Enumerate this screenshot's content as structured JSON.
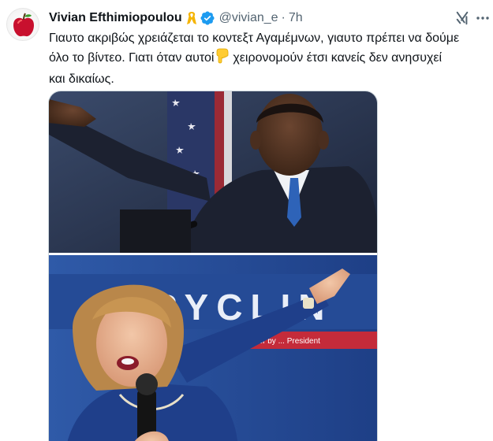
{
  "author": {
    "display_name": "Vivian Efthimiopoulou",
    "handle": "@vivian_e",
    "separator": "·",
    "time": "7h",
    "avatar_icon": "red-apple-icon",
    "badge_icons": [
      "yellow-ribbon-icon",
      "verified-badge-icon"
    ]
  },
  "tweet": {
    "text_lines": [
      "Γιαυτο ακριβώς χρειάζεται το κοντεξτ Αγαμέμνων, γιαυτο πρέπει να δούμε",
      "όλο το βίντεο. Γιατι όταν αυτοί",
      "χειρονομούν έτσι κανείς δεν ανησυχεί",
      "και δικαίως."
    ],
    "inline_emoji": "pointing-down-hand-icon"
  },
  "media": {
    "banner_text": "RYCLIN",
    "banner_small_text": "Paid for by ... President"
  },
  "actions": {
    "grok_icon": "grok-icon",
    "more_icon": "more-icon"
  },
  "colors": {
    "verified": "#1d9bf0",
    "ribbon": "#f5b400",
    "text": "#0f1419",
    "secondary": "#536471"
  }
}
